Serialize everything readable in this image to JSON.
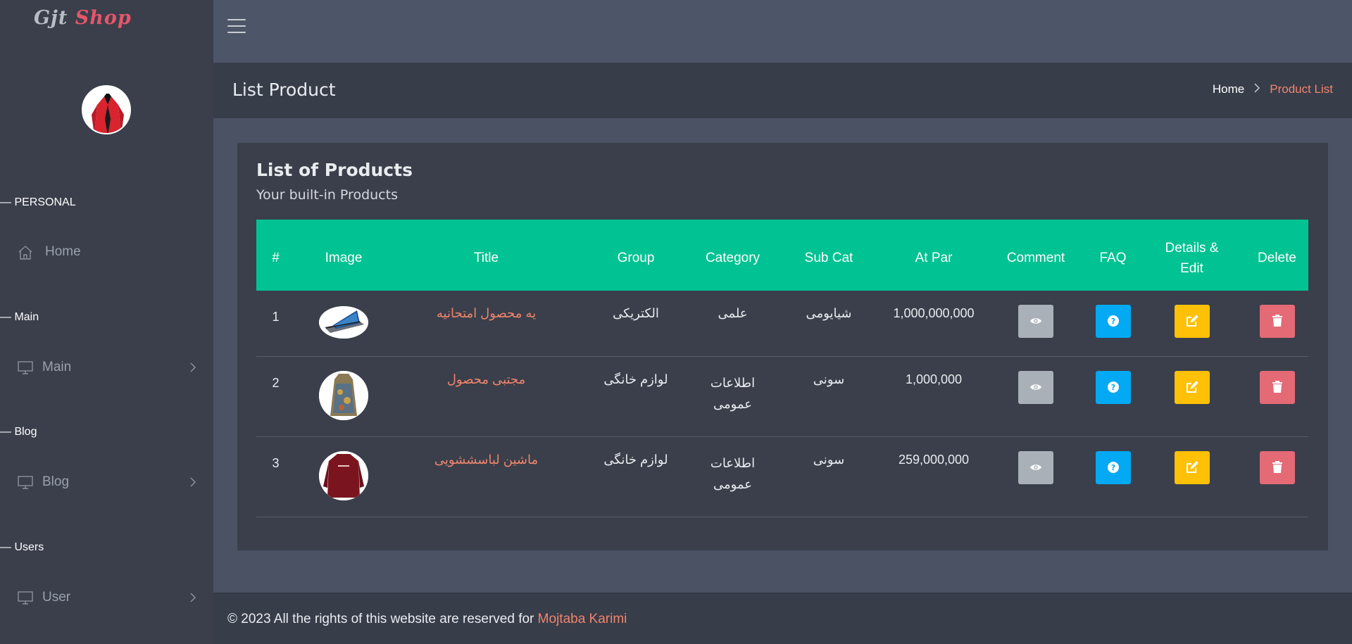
{
  "logo": {
    "part1": "Gjt",
    "part2": "Shop"
  },
  "sidebar": {
    "sections": [
      {
        "title": "— PERSONAL"
      },
      {
        "title": "— Main"
      },
      {
        "title": "— Blog"
      },
      {
        "title": "— Users"
      }
    ],
    "items": [
      {
        "label": "Home",
        "icon": "home-icon"
      },
      {
        "label": "Main",
        "icon": "monitor-icon"
      },
      {
        "label": "Blog",
        "icon": "monitor-icon"
      },
      {
        "label": "User",
        "icon": "monitor-icon"
      }
    ]
  },
  "header": {
    "page_title": "List Product",
    "breadcrumb": {
      "home": "Home",
      "current": "Product List"
    }
  },
  "card": {
    "title": "List of Products",
    "subtitle": "Your built-in Products"
  },
  "table": {
    "columns": [
      "#",
      "Image",
      "Title",
      "Group",
      "Category",
      "Sub Cat",
      "At Par",
      "Comment",
      "FAQ",
      "Details & Edit",
      "Delete"
    ],
    "rows": [
      {
        "num": "1",
        "title": "یه محصول امتحانیه",
        "group": "الکتریکی",
        "category": "علمی",
        "subcat": "شیایومی",
        "price": "1,000,000,000"
      },
      {
        "num": "2",
        "title": "مجتبی محصول",
        "group": "لوازم خانگی",
        "category": "اطلاعات عمومی",
        "subcat": "سونی",
        "price": "1,000,000"
      },
      {
        "num": "3",
        "title": "ماشین لباسششویی",
        "group": "لوازم خانگی",
        "category": "اطلاعات عمومی",
        "subcat": "سونی",
        "price": "259,000,000"
      }
    ]
  },
  "footer": {
    "text": "© 2023 All the rights of this website are reserved for ",
    "author": "Mojtaba Karimi"
  },
  "colors": {
    "accent": "#00c292",
    "link": "#f0856b",
    "btn_view": "#aab0b8",
    "btn_faq": "#03a9f3",
    "btn_edit": "#fec107",
    "btn_delete": "#e46a76"
  }
}
